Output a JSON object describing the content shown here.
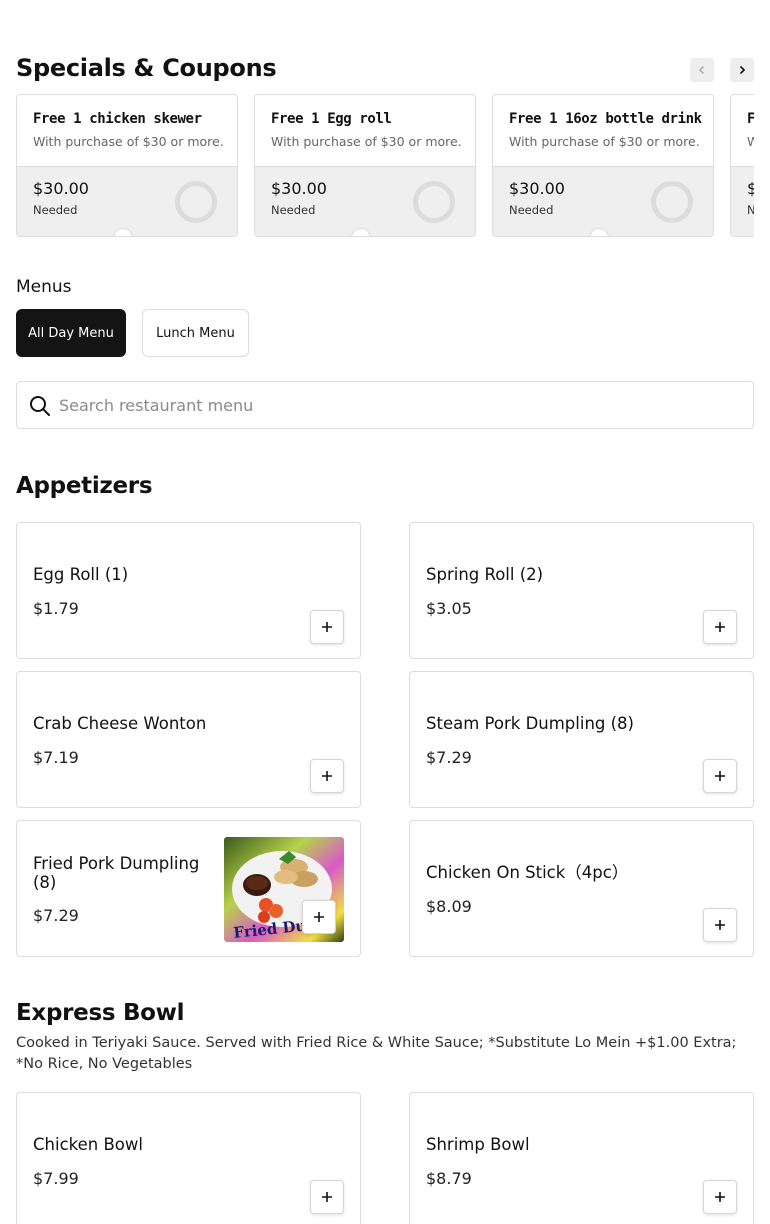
{
  "specials": {
    "title": "Specials & Coupons",
    "prev_icon": "chevron-left-icon",
    "next_icon": "chevron-right-icon",
    "coupons": [
      {
        "title": "Free 1 chicken skewer",
        "description": "With purchase of $30 or more.",
        "amount": "$30.00",
        "needed_label": "Needed",
        "progress": 0
      },
      {
        "title": "Free 1 Egg roll",
        "description": "With purchase of $30 or more.",
        "amount": "$30.00",
        "needed_label": "Needed",
        "progress": 0
      },
      {
        "title": "Free 1 16oz bottle drink",
        "description": "With purchase of $30 or more.",
        "amount": "$30.00",
        "needed_label": "Needed",
        "progress": 0
      },
      {
        "title": "F",
        "description": "W",
        "amount": "$",
        "needed_label": "N",
        "progress": 0
      }
    ]
  },
  "menus": {
    "label": "Menus",
    "tabs": [
      {
        "label": "All Day Menu",
        "active": true
      },
      {
        "label": "Lunch Menu",
        "active": false
      }
    ]
  },
  "search": {
    "placeholder": "Search restaurant menu",
    "value": "",
    "icon": "search-icon"
  },
  "sections": [
    {
      "title": "Appetizers",
      "description": "",
      "items": [
        {
          "name": "Egg Roll (1)",
          "price": "$1.79"
        },
        {
          "name": "Spring Roll (2)",
          "price": "$3.05"
        },
        {
          "name": "Crab Cheese Wonton",
          "price": "$7.19"
        },
        {
          "name": "Steam Pork Dumpling (8)",
          "price": "$7.29"
        },
        {
          "name": "Fried Pork Dumpling (8)",
          "price": "$7.29",
          "photo_caption": "Fried Dum"
        },
        {
          "name": "Chicken On Stick（4pc）",
          "price": "$8.09"
        }
      ]
    },
    {
      "title": "Express Bowl",
      "description": "Cooked in Teriyaki Sauce. Served with Fried Rice & White Sauce; *Substitute Lo Mein +$1.00 Extra; *No Rice, No Vegetables",
      "items": [
        {
          "name": "Chicken Bowl",
          "price": "$7.99"
        },
        {
          "name": "Shrimp Bowl",
          "price": "$8.79"
        }
      ]
    }
  ],
  "colors": {
    "accent_dark": "#141414",
    "border": "#dcdcdc",
    "coupon_bottom": "#efefef"
  }
}
